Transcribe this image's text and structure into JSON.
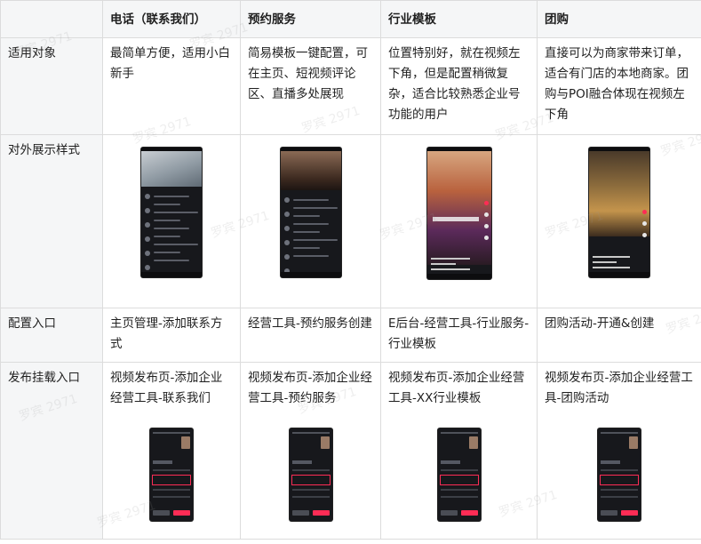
{
  "table": {
    "header": [
      "",
      "电话（联系我们）",
      "预约服务",
      "行业模板",
      "团购"
    ],
    "rows": {
      "scope": {
        "label": "适用对象",
        "cells": [
          "最简单方便，适用小白新手",
          "简易模板一键配置，可在主页、短视频评论区、直播多处展现",
          "位置特别好，就在视频左下角，但是配置稍微复杂，适合比较熟悉企业号功能的用户",
          "直接可以为商家带来订单，适合有门店的本地商家。团购与POI融合体现在视频左下角"
        ]
      },
      "style": {
        "label": "对外展示样式",
        "images": [
          "phone-call-preview",
          "booking-service-preview",
          "industry-template-preview",
          "group-buy-preview"
        ]
      },
      "config": {
        "label": "配置入口",
        "cells": [
          "主页管理-添加联系方式",
          "经营工具-预约服务创建",
          "E后台-经营工具-行业服务-行业模板",
          "团购活动-开通&创建"
        ]
      },
      "publish": {
        "label": "发布挂载入口",
        "cells": [
          "视频发布页-添加企业经营工具-联系我们",
          "视频发布页-添加企业经营工具-预约服务",
          "视频发布页-添加企业经营工具-XX行业模板",
          "视频发布页-添加企业经营工具-团购活动"
        ]
      }
    }
  },
  "watermark": "罗宾 2971"
}
